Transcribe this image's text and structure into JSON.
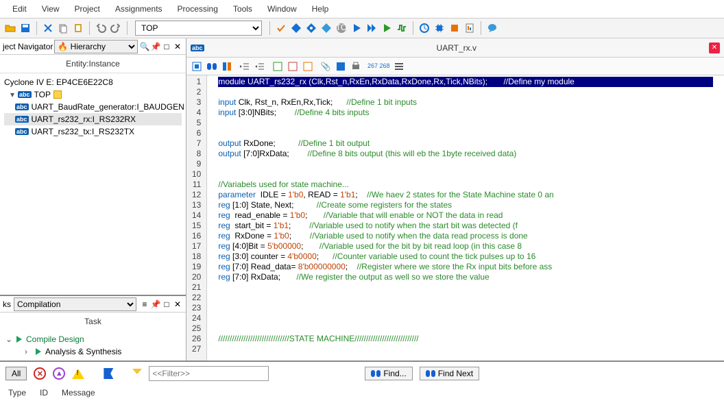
{
  "menu": [
    "Edit",
    "View",
    "Project",
    "Assignments",
    "Processing",
    "Tools",
    "Window",
    "Help"
  ],
  "top_dropdown": "TOP",
  "nav": {
    "title": "ject Navigator",
    "dropdown": "Hierarchy",
    "entity_label": "Entity:Instance",
    "device": "Cyclone IV E: EP4CE6E22C8",
    "top": "TOP",
    "items": [
      "UART_BaudRate_generator:I_BAUDGEN",
      "UART_rs232_rx:I_RS232RX",
      "UART_rs232_tx:I_RS232TX"
    ],
    "selected_index": 1
  },
  "tasks": {
    "ks_label": "ks",
    "dropdown": "Compilation",
    "title": "Task",
    "items": [
      "Compile Design",
      "Analysis & Synthesis"
    ]
  },
  "editor": {
    "filename": "UART_rx.v",
    "linecount_label": "267\n268",
    "lines": [
      {
        "n": 1,
        "hl": true,
        "raw": "module UART_rs232_rx (Clk,Rst_n,RxEn,RxData,RxDone,Rx,Tick,NBits);       //Define my module"
      },
      {
        "n": 2,
        "raw": ""
      },
      {
        "n": 3,
        "raw": "input Clk, Rst_n, RxEn,Rx,Tick;      //Define 1 bit inputs",
        "kw": "input",
        "cm": "//Define 1 bit inputs"
      },
      {
        "n": 4,
        "raw": "input [3:0]NBits;        //Define 4 bits inputs",
        "kw": "input",
        "cm": "//Define 4 bits inputs"
      },
      {
        "n": 5,
        "raw": ""
      },
      {
        "n": 6,
        "raw": ""
      },
      {
        "n": 7,
        "raw": "output RxDone;          //Define 1 bit output",
        "kw": "output",
        "cm": "//Define 1 bit output"
      },
      {
        "n": 8,
        "raw": "output [7:0]RxData;        //Define 8 bits output (this will eb the 1byte received data)",
        "kw": "output",
        "cm": "//Define 8 bits output (this will eb the 1byte received data)"
      },
      {
        "n": 9,
        "raw": ""
      },
      {
        "n": 10,
        "raw": ""
      },
      {
        "n": 11,
        "raw": "//Variabels used for state machine...",
        "cm": "//Variabels used for state machine..."
      },
      {
        "n": 12,
        "raw": "parameter  IDLE = 1'b0, READ = 1'b1;    //We haev 2 states for the State Machine state 0 an",
        "kw": "parameter",
        "num": [
          "1'b0",
          "1'b1"
        ],
        "cm": "//We haev 2 states for the State Machine state 0 an"
      },
      {
        "n": 13,
        "raw": "reg [1:0] State, Next;          //Create some registers for the states",
        "kw": "reg",
        "cm": "//Create some registers for the states"
      },
      {
        "n": 14,
        "raw": "reg  read_enable = 1'b0;       //Variable that will enable or NOT the data in read",
        "kw": "reg",
        "num": [
          "1'b0"
        ],
        "cm": "//Variable that will enable or NOT the data in read"
      },
      {
        "n": 15,
        "raw": "reg  start_bit = 1'b1;        //Variable used to notify when the start bit was detected (f",
        "kw": "reg",
        "num": [
          "1'b1"
        ],
        "cm": "//Variable used to notify when the start bit was detected (f"
      },
      {
        "n": 16,
        "raw": "reg  RxDone = 1'b0;        //Variable used to notify when the data read process is done",
        "kw": "reg",
        "num": [
          "1'b0"
        ],
        "cm": "//Variable used to notify when the data read process is done"
      },
      {
        "n": 17,
        "raw": "reg [4:0]Bit = 5'b00000;       //Variable used for the bit by bit read loop (in this case 8",
        "kw": "reg",
        "num": [
          "5'b00000"
        ],
        "cm": "//Variable used for the bit by bit read loop (in this case 8"
      },
      {
        "n": 18,
        "raw": "reg [3:0] counter = 4'b0000;      //Counter variable used to count the tick pulses up to 16",
        "kw": "reg",
        "num": [
          "4'b0000"
        ],
        "cm": "//Counter variable used to count the tick pulses up to 16"
      },
      {
        "n": 19,
        "raw": "reg [7:0] Read_data= 8'b00000000;    //Register where we store the Rx input bits before ass",
        "kw": "reg",
        "num": [
          "8'b00000000"
        ],
        "cm": "//Register where we store the Rx input bits before ass"
      },
      {
        "n": 20,
        "raw": "reg [7:0] RxData;       //We register the output as well so we store the value",
        "kw": "reg",
        "cm": "//We register the output as well so we store the value"
      },
      {
        "n": 21,
        "raw": ""
      },
      {
        "n": 22,
        "raw": ""
      },
      {
        "n": 23,
        "raw": ""
      },
      {
        "n": 24,
        "raw": ""
      },
      {
        "n": 25,
        "raw": ""
      },
      {
        "n": 26,
        "raw": "///////////////////////////////STATE MACHINE////////////////////////////",
        "cm": "///////////////////////////////STATE MACHINE////////////////////////////"
      },
      {
        "n": 27,
        "raw": ""
      }
    ]
  },
  "bottom": {
    "all": "All",
    "filter_placeholder": "<<Filter>>",
    "find": "Find...",
    "find_next": "Find Next",
    "cols": [
      "Type",
      "ID",
      "Message"
    ]
  }
}
